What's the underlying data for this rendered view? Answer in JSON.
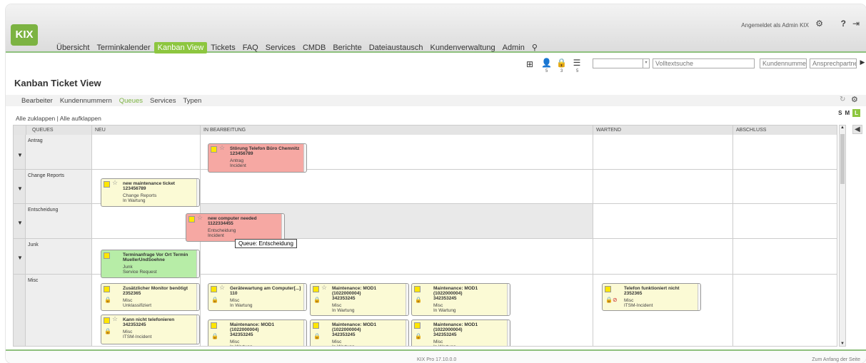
{
  "app": {
    "logo": "KIX",
    "user_text": "Angemeldet als Admin KIX"
  },
  "nav": [
    "Übersicht",
    "Terminkalender",
    "Kanban View",
    "Tickets",
    "FAQ",
    "Services",
    "CMDB",
    "Berichte",
    "Dateiaustausch",
    "Kundenverwaltung",
    "Admin"
  ],
  "toolbar": {
    "counts": [
      "5",
      "3",
      "5"
    ],
    "search_placeholder": "Volltextsuche",
    "customer_no": "Kundennummer",
    "contact": "Ansprechpartner"
  },
  "page": {
    "title": "Kanban Ticket View",
    "collapse": "Alle zuklappen | Alle aufklappen"
  },
  "subtabs": [
    "Bearbeiter",
    "Kundennummern",
    "Queues",
    "Services",
    "Typen"
  ],
  "sizes": [
    "S",
    "M",
    "L"
  ],
  "columns": [
    "QUEUES",
    "NEU",
    "IN BEARBEITUNG",
    "WARTEND",
    "ABSCHLUSS"
  ],
  "queues": [
    "Antrag",
    "Change Reports",
    "Entscheidung",
    "Junk",
    "Misc"
  ],
  "cards": [
    {
      "title": "Störung Telefon Büro Chemnitz",
      "no": "123456789",
      "queue": "Antrag",
      "state": "Incident"
    },
    {
      "title": "new maintenance ticket",
      "no": "123456789",
      "queue": "Change Reports",
      "state": "In Wartung"
    },
    {
      "title": "new computer needed",
      "no": "1122334455",
      "queue": "Entscheidung",
      "state": "Incident"
    },
    {
      "title": "Terminanfrage Vor Ort Termin MuellerUndSoehne",
      "no": "",
      "queue": "Junk",
      "state": "Service Request"
    },
    {
      "title": "Zusätzlicher Monitor benötigt",
      "no": "2352365",
      "queue": "Misc",
      "state": "Unklassifiziert"
    },
    {
      "title": "Kann nicht telefonieren",
      "no": "342353245",
      "queue": "Misc",
      "state": "ITSM-Incident"
    },
    {
      "title": "Gerätewartung am Computer[...]",
      "no": "110",
      "queue": "Misc",
      "state": "In Wartung"
    },
    {
      "title": "Maintenance: MOD1 (1022000004)",
      "no": "342353245",
      "queue": "Misc",
      "state": "In Wartung"
    },
    {
      "title": "Maintenance: MOD1 (1022000004)",
      "no": "342353245",
      "queue": "Misc",
      "state": "In Wartung"
    },
    {
      "title": "Maintenance: MOD1 (1022000004)",
      "no": "342353245",
      "queue": "Misc",
      "state": "In Wartung"
    },
    {
      "title": "Maintenance: MOD1 (1022000004)",
      "no": "342353245",
      "queue": "Misc",
      "state": "In Wartung"
    },
    {
      "title": "Maintenance: MOD1 (1022000004)",
      "no": "342353245",
      "queue": "Misc",
      "state": "In Wartung"
    },
    {
      "title": "Telefon funktioniert nicht",
      "no": "2352365",
      "queue": "Misc",
      "state": "ITSM-Incident"
    }
  ],
  "tooltip": "Queue: Entscheidung",
  "footer": {
    "version": "KIX Pro 17.10.0.0",
    "top_link": "Zum Anfang der Seite"
  }
}
